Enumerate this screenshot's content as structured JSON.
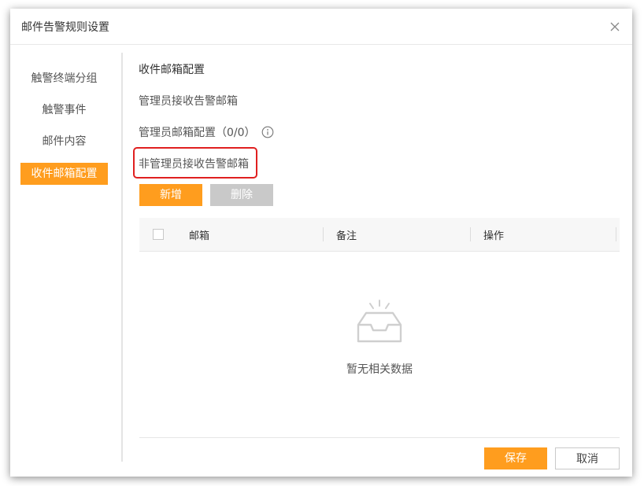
{
  "dialog": {
    "title": "邮件告警规则设置"
  },
  "sidebar": {
    "items": [
      {
        "label": "触警终端分组"
      },
      {
        "label": "触警事件"
      },
      {
        "label": "邮件内容"
      },
      {
        "label": "收件邮箱配置",
        "active": true
      }
    ]
  },
  "main": {
    "section_title": "收件邮箱配置",
    "admin_label": "管理员接收告警邮箱",
    "admin_config_label": "管理员邮箱配置（0/0）",
    "non_admin_label": "非管理员接收告警邮箱",
    "add_button": "新增",
    "delete_button": "删除",
    "table": {
      "columns": [
        "邮箱",
        "备注",
        "操作"
      ],
      "rows": [],
      "empty_text": "暂无相关数据"
    }
  },
  "footer": {
    "save_button": "保存",
    "cancel_button": "取消"
  },
  "colors": {
    "accent": "#ff9d1e",
    "disabled": "#c9c9c9",
    "highlight": "#e02020"
  },
  "icons": {
    "close": "close-icon",
    "info": "info-icon",
    "empty": "empty-inbox-icon"
  }
}
